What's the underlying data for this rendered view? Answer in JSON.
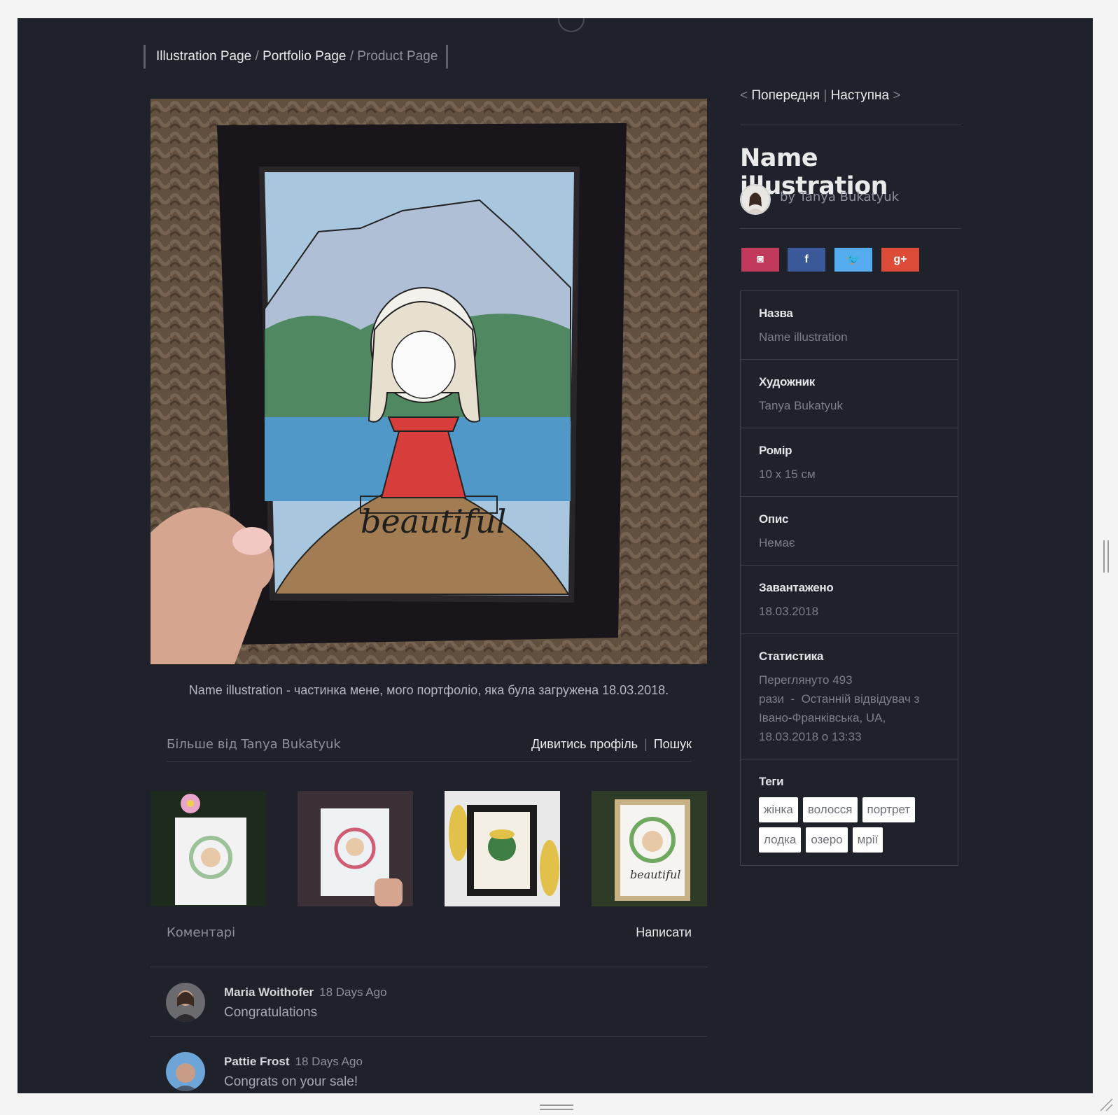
{
  "breadcrumb": {
    "items": [
      "Illustration Page",
      "Portfolio Page"
    ],
    "separator": "/",
    "current": "Product Page"
  },
  "main": {
    "caption": "Name illustration - частинка мене, мого портфоліо, яка була загружена 18.03.2018.",
    "more_label": "Більше від Tanya Bukatyuk",
    "view_profile": "Дивитись профіль",
    "search": "Пошук",
    "link_separator": "|",
    "comments_label": "Коментарі",
    "write_label": "Написати",
    "comments": [
      {
        "author": "Maria Woithofer",
        "ago": "18 Days Ago",
        "text": "Congratulations"
      },
      {
        "author": "Pattie Frost",
        "ago": "18 Days Ago",
        "text": "Congrats on your sale!"
      }
    ]
  },
  "side": {
    "prev": "Попередня",
    "next": "Наступна",
    "prev_arrow": "<",
    "next_arrow": ">",
    "nav_separator": "|",
    "title": "Name illustration",
    "byline": "by Tanya Bukatyuk",
    "social": [
      {
        "icon": "instagram-icon",
        "glyph": "◙",
        "color": "#c13a5c"
      },
      {
        "icon": "facebook-icon",
        "glyph": "f",
        "color": "#3b5998"
      },
      {
        "icon": "twitter-icon",
        "glyph": "🐦",
        "color": "#55acee"
      },
      {
        "icon": "google-plus-icon",
        "glyph": "g+",
        "color": "#dd4b39"
      }
    ],
    "info": {
      "name_label": "Назва",
      "name_value": "Name illustration",
      "artist_label": "Художник",
      "artist_value": "Tanya Bukatyuk",
      "size_label": "Ромір",
      "size_value": "10 x 15 см",
      "desc_label": "Опис",
      "desc_value": "Немає",
      "uploaded_label": "Завантажено",
      "uploaded_value": "18.03.2018",
      "stats_label": "Статистика",
      "stats_lines": [
        "Переглянуто 493",
        "рази  -  Останній відвідувач з",
        "Івано-Франківська, UA,",
        "18.03.2018 о 13:33"
      ],
      "tags_label": "Теги",
      "tags": [
        "жінка",
        "волосся",
        "портрет",
        "лодка",
        "озеро",
        "мрії"
      ]
    }
  }
}
